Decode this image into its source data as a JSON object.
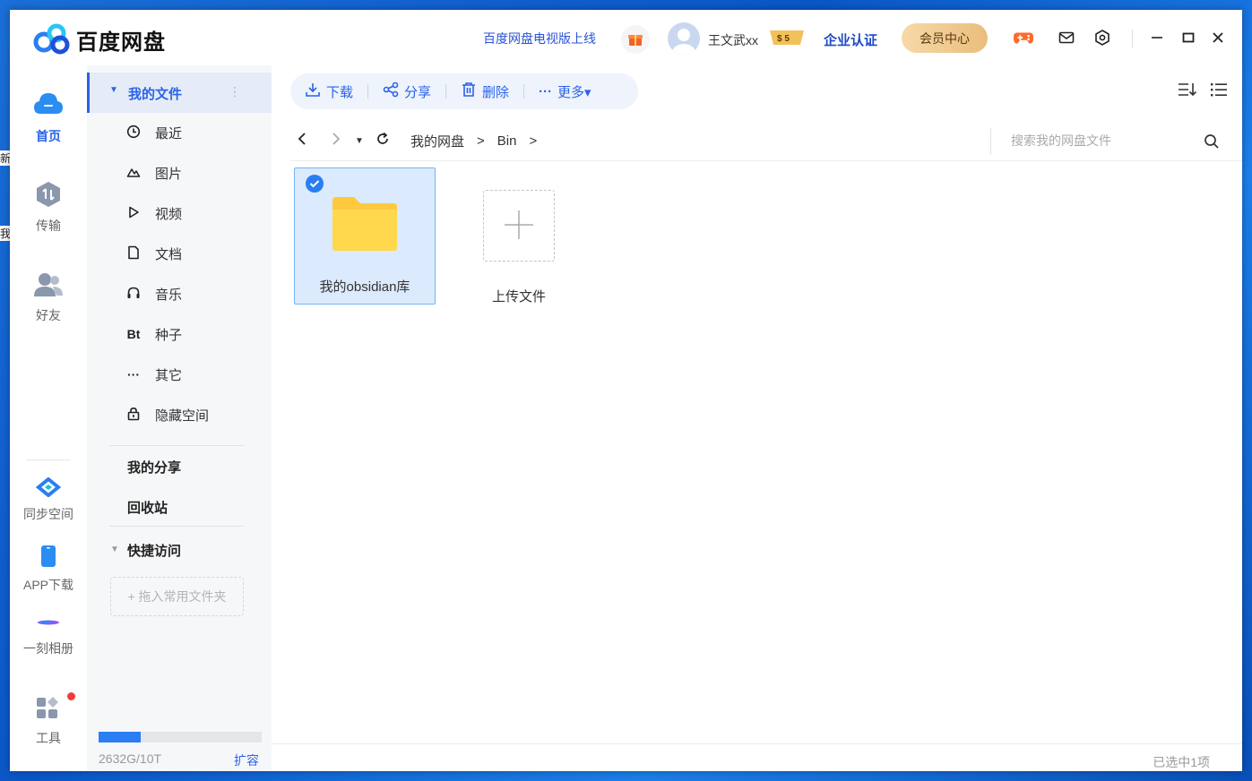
{
  "desktop": {
    "edge_text_1": "新",
    "edge_text_2": "我"
  },
  "app": {
    "logo_text": "百度网盘"
  },
  "header": {
    "tv_link": "百度网盘电视版上线",
    "username": "王文武xx",
    "vip_badge": "$ 5",
    "enterprise_label": "企业认证",
    "member_center_label": "会员中心"
  },
  "leftnav": {
    "items": [
      {
        "label": "首页"
      },
      {
        "label": "传输"
      },
      {
        "label": "好友"
      },
      {
        "label": "同步空间"
      },
      {
        "label": "APP下载"
      },
      {
        "label": "一刻相册"
      },
      {
        "label": "工具"
      }
    ]
  },
  "sidebar": {
    "my_files_label": "我的文件",
    "items": [
      {
        "label": "最近",
        "icon": "clock-icon"
      },
      {
        "label": "图片",
        "icon": "image-icon"
      },
      {
        "label": "视频",
        "icon": "play-icon"
      },
      {
        "label": "文档",
        "icon": "document-icon"
      },
      {
        "label": "音乐",
        "icon": "headphones-icon"
      },
      {
        "label": "种子",
        "icon_text": "Bt"
      },
      {
        "label": "其它",
        "icon_text": "···"
      },
      {
        "label": "隐藏空间",
        "icon": "lock-icon"
      }
    ],
    "my_share_label": "我的分享",
    "recycle_label": "回收站",
    "quick_access_label": "快捷访问",
    "drop_hint": "+ 拖入常用文件夹",
    "quota_text": "2632G/10T",
    "quota_fraction": 0.26,
    "expand_label": "扩容"
  },
  "toolbar": {
    "download_label": "下载",
    "share_label": "分享",
    "delete_label": "删除",
    "more_label": "更多▾"
  },
  "path": {
    "crumbs": [
      "我的网盘",
      "Bin"
    ],
    "separator": ">"
  },
  "search": {
    "placeholder": "搜索我的网盘文件"
  },
  "files": [
    {
      "name": "我的obsidian库",
      "type": "folder",
      "selected": true
    }
  ],
  "upload_label": "上传文件",
  "status": {
    "selection_text": "已选中1项"
  },
  "colors": {
    "accent": "#2a63e8",
    "folder": "#ffd43b",
    "selected_bg": "#dbeafc"
  }
}
